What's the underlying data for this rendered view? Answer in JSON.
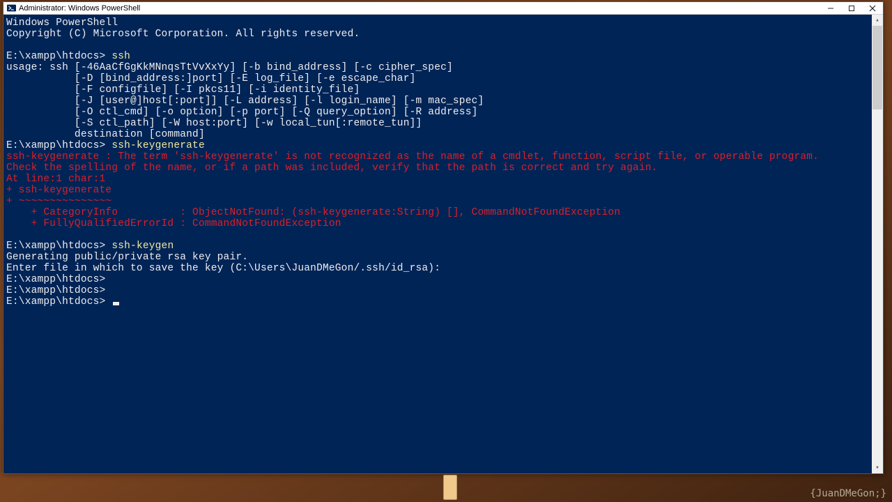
{
  "window": {
    "title": "Administrator: Windows PowerShell"
  },
  "terminal": {
    "banner1": "Windows PowerShell",
    "banner2": "Copyright (C) Microsoft Corporation. All rights reserved.",
    "prompt": "E:\\xampp\\htdocs>",
    "cmd1": "ssh",
    "usage1": "usage: ssh [-46AaCfGgKkMNnqsTtVvXxYy] [-b bind_address] [-c cipher_spec]",
    "usage2": "           [-D [bind_address:]port] [-E log_file] [-e escape_char]",
    "usage3": "           [-F configfile] [-I pkcs11] [-i identity_file]",
    "usage4": "           [-J [user@]host[:port]] [-L address] [-l login_name] [-m mac_spec]",
    "usage5": "           [-O ctl_cmd] [-o option] [-p port] [-Q query_option] [-R address]",
    "usage6": "           [-S ctl_path] [-W host:port] [-w local_tun[:remote_tun]]",
    "usage7": "           destination [command]",
    "cmd2": "ssh-keygenerate",
    "err1": "ssh-keygenerate : The term 'ssh-keygenerate' is not recognized as the name of a cmdlet, function, script file, or operable program.",
    "err2": "Check the spelling of the name, or if a path was included, verify that the path is correct and try again.",
    "err3": "At line:1 char:1",
    "err4": "+ ssh-keygenerate",
    "err5": "+ ~~~~~~~~~~~~~~~",
    "err6": "    + CategoryInfo          : ObjectNotFound: (ssh-keygenerate:String) [], CommandNotFoundException",
    "err7": "    + FullyQualifiedErrorId : CommandNotFoundException",
    "cmd3": "ssh-keygen",
    "gen1": "Generating public/private rsa key pair.",
    "gen2": "Enter file in which to save the key (C:\\Users\\JuanDMeGon/.ssh/id_rsa):"
  },
  "watermark": "{JuanDMeGon;}"
}
